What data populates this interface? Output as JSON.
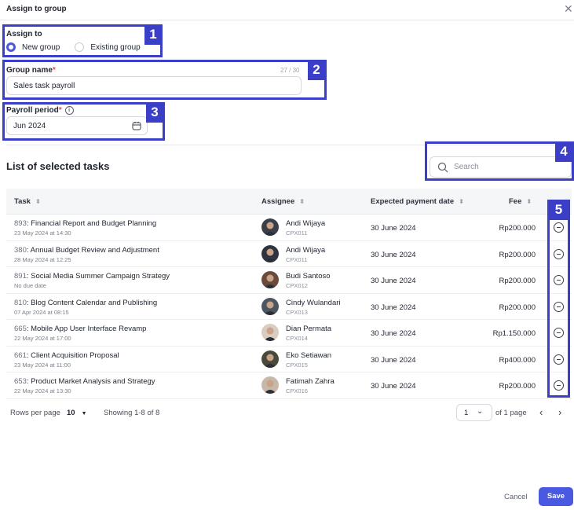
{
  "dialog": {
    "title": "Assign to group"
  },
  "assign_to": {
    "label": "Assign to",
    "options": [
      {
        "label": "New group",
        "selected": true
      },
      {
        "label": "Existing group",
        "selected": false
      }
    ]
  },
  "group_name": {
    "label": "Group name",
    "required_mark": "*",
    "value": "Sales task payroll",
    "counter": "27 / 30"
  },
  "payroll_period": {
    "label": "Payroll period",
    "required_mark": "*",
    "info": "i",
    "value": "Jun 2024"
  },
  "tasks_section": {
    "title": "List of selected tasks",
    "search_placeholder": "Search"
  },
  "table": {
    "headers": {
      "task": "Task",
      "assignee": "Assignee",
      "payment_date": "Expected payment date",
      "fee": "Fee"
    },
    "rows": [
      {
        "id": "893",
        "name": ": Financial Report and Budget Planning",
        "date": "23 May 2024 at 14:30",
        "assignee": "Andi Wijaya",
        "code": "CPX011",
        "pay_date": "30 June 2024",
        "fee": "Rp200.000"
      },
      {
        "id": "380",
        "name": ": Annual Budget Review and Adjustment",
        "date": "28 May 2024 at 12:25",
        "assignee": "Andi Wijaya",
        "code": "CPX011",
        "pay_date": "30 June 2024",
        "fee": "Rp200.000"
      },
      {
        "id": "891",
        "name": ": Social Media Summer Campaign Strategy",
        "date": "No due date",
        "assignee": "Budi Santoso",
        "code": "CPX012",
        "pay_date": "30 June 2024",
        "fee": "Rp200.000"
      },
      {
        "id": "810",
        "name": ": Blog Content Calendar and Publishing",
        "date": "07 Apr 2024 at 08:15",
        "assignee": "Cindy Wulandari",
        "code": "CPX013",
        "pay_date": "30 June 2024",
        "fee": "Rp200.000"
      },
      {
        "id": "665",
        "name": ": Mobile App User Interface Revamp",
        "date": "22 May 2024 at 17:00",
        "assignee": "Dian Permata",
        "code": "CPX014",
        "pay_date": "30 June 2024",
        "fee": "Rp1.150.000"
      },
      {
        "id": "661",
        "name": ": Client Acquisition Proposal",
        "date": "23 May 2024 at 11:00",
        "assignee": "Eko Setiawan",
        "code": "CPX015",
        "pay_date": "30 June 2024",
        "fee": "Rp400.000"
      },
      {
        "id": "653",
        "name": ": Product Market Analysis and Strategy",
        "date": "22 May 2024 at 13:30",
        "assignee": "Fatimah Zahra",
        "code": "CPX016",
        "pay_date": "30 June 2024",
        "fee": "Rp200.000"
      }
    ]
  },
  "pagination": {
    "rows_per_page_label": "Rows per page",
    "rows_per_page": "10",
    "showing": "Showing 1-8 of 8",
    "page": "1",
    "of_pages": "of 1 page"
  },
  "actions": {
    "cancel": "Cancel",
    "save": "Save"
  },
  "annotations": [
    "1",
    "2",
    "3",
    "4",
    "5"
  ],
  "colors": {
    "accent": "#4a5ae0",
    "annotation": "#3b3fc7",
    "required": "#e5484d"
  },
  "avatar_colors": [
    "#3a3f4a",
    "#2f3540",
    "#6b4a3a",
    "#4d5560",
    "#d9cdbf",
    "#4a4a3a",
    "#c8b8a8"
  ]
}
